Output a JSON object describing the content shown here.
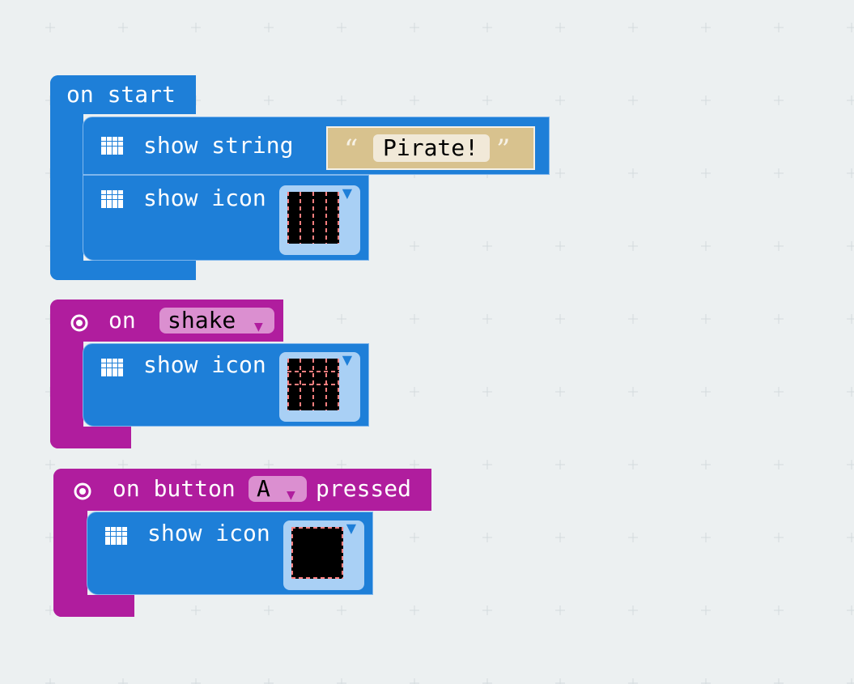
{
  "blocks": {
    "on_start": {
      "label": "on start",
      "show_string": {
        "label": "show string",
        "value": "Pirate!",
        "open_quote": "“",
        "close_quote": "”"
      },
      "show_icon": {
        "label": "show icon"
      }
    },
    "on_shake": {
      "on_label": "on",
      "gesture": "shake",
      "show_icon": {
        "label": "show icon"
      }
    },
    "on_button": {
      "on_button_label": "on button",
      "button": "A",
      "pressed_label": "pressed",
      "show_icon": {
        "label": "show icon"
      }
    }
  },
  "icons": {
    "basic_category": "grid-icon",
    "input_category": "radio-icon",
    "dropdown": "triangle-down-icon"
  },
  "colors": {
    "workspace": "#ecf0f1",
    "basic_block": "#1e7fd8",
    "input_block": "#b01d9e",
    "dropdown_field": "#db8fd0",
    "string_block": "#d8c28e",
    "led_on": "#ff7f7f",
    "led_off": "#000000"
  }
}
